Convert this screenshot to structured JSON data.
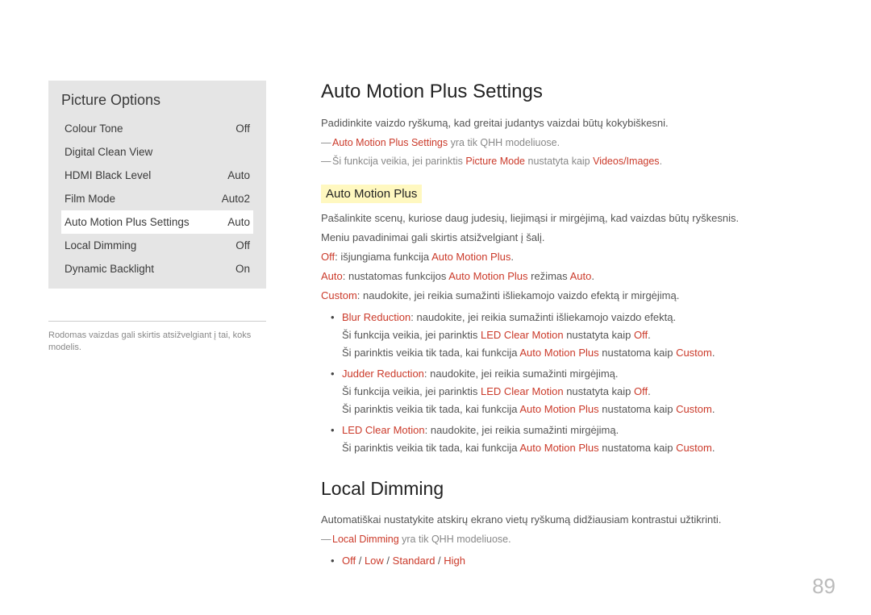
{
  "panel": {
    "title": "Picture Options",
    "rows": [
      {
        "label": "Colour Tone",
        "value": "Off"
      },
      {
        "label": "Digital Clean View",
        "value": ""
      },
      {
        "label": "HDMI Black Level",
        "value": "Auto"
      },
      {
        "label": "Film Mode",
        "value": "Auto2"
      },
      {
        "label": "Auto Motion Plus Settings",
        "value": "Auto"
      },
      {
        "label": "Local Dimming",
        "value": "Off"
      },
      {
        "label": "Dynamic Backlight",
        "value": "On"
      }
    ],
    "note": "Rodomas vaizdas gali skirtis atsižvelgiant į tai, koks modelis."
  },
  "sections": {
    "amp_title": "Auto Motion Plus Settings",
    "amp_desc": "Padidinkite vaizdo ryškumą, kad greitai judantys vaizdai būtų kokybiškesni.",
    "amp_note1_a": "Auto Motion Plus Settings",
    "amp_note1_b": " yra tik QHH modeliuose.",
    "amp_note2_a": "Ši funkcija veikia, jei parinktis ",
    "amp_note2_b": "Picture Mode",
    "amp_note2_c": " nustatyta kaip ",
    "amp_note2_d": "Videos/Images",
    "amp_note2_e": ".",
    "sub_title": "Auto Motion Plus",
    "sub_desc1": "Pašalinkite scenų, kuriose daug judesių, liejimąsi ir mirgėjimą, kad vaizdas būtų ryškesnis.",
    "sub_desc2": "Meniu pavadinimai gali skirtis atsižvelgiant į šalį.",
    "off_a": "Off",
    "off_b": ": išjungiama funkcija ",
    "off_c": "Auto Motion Plus",
    "off_d": ".",
    "auto_a": "Auto",
    "auto_b": ": nustatomas funkcijos ",
    "auto_c": "Auto Motion Plus",
    "auto_d": " režimas ",
    "auto_e": "Auto",
    "auto_f": ".",
    "custom_a": "Custom",
    "custom_b": ": naudokite, jei reikia sumažinti išliekamojo vaizdo efektą ir mirgėjimą.",
    "bul1_a": "Blur Reduction",
    "bul1_b": ": naudokite, jei reikia sumažinti išliekamojo vaizdo efektą.",
    "bul1_s1a": "Ši funkcija veikia, jei parinktis ",
    "bul1_s1b": "LED Clear Motion",
    "bul1_s1c": " nustatyta kaip ",
    "bul1_s1d": "Off",
    "bul1_s1e": ".",
    "bul1_s2a": "Ši parinktis veikia tik tada, kai funkcija ",
    "bul1_s2b": "Auto Motion Plus",
    "bul1_s2c": " nustatoma kaip ",
    "bul1_s2d": "Custom",
    "bul1_s2e": ".",
    "bul2_a": "Judder Reduction",
    "bul2_b": ": naudokite, jei reikia sumažinti mirgėjimą.",
    "bul2_s1a": "Ši funkcija veikia, jei parinktis ",
    "bul2_s1b": "LED Clear Motion",
    "bul2_s1c": " nustatyta kaip ",
    "bul2_s1d": "Off",
    "bul2_s1e": ".",
    "bul2_s2a": "Ši parinktis veikia tik tada, kai funkcija ",
    "bul2_s2b": "Auto Motion Plus",
    "bul2_s2c": " nustatoma kaip ",
    "bul2_s2d": "Custom",
    "bul2_s2e": ".",
    "bul3_a": "LED Clear Motion",
    "bul3_b": ": naudokite, jei reikia sumažinti mirgėjimą.",
    "bul3_s1a": "Ši parinktis veikia tik tada, kai funkcija ",
    "bul3_s1b": "Auto Motion Plus",
    "bul3_s1c": " nustatoma kaip ",
    "bul3_s1d": "Custom",
    "bul3_s1e": ".",
    "ld_title": "Local Dimming",
    "ld_desc": "Automatiškai nustatykite atskirų ekrano vietų ryškumą didžiausiam kontrastui užtikrinti.",
    "ld_note_a": "Local Dimming",
    "ld_note_b": " yra tik QHH modeliuose.",
    "ld_opts_off": "Off",
    "ld_opts_low": "Low",
    "ld_opts_std": "Standard",
    "ld_opts_high": "High",
    "ld_slash": " / "
  },
  "page": "89"
}
